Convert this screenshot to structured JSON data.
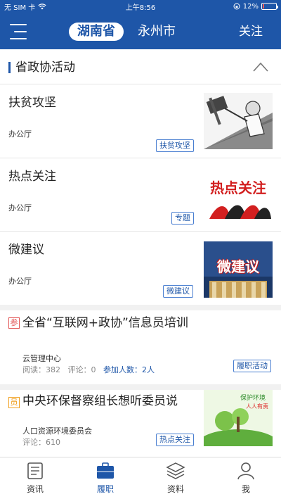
{
  "status": {
    "carrier": "无 SIM 卡",
    "time": "上午8:56",
    "battery": "12%",
    "battery_level": 0.12
  },
  "header": {
    "province": "湖南省",
    "city": "永州市",
    "follow_label": "关注"
  },
  "section": {
    "title": "省政协活动"
  },
  "items": [
    {
      "title": "扶贫攻坚",
      "source": "办公厅",
      "tag": "扶贫攻坚"
    },
    {
      "title": "热点关注",
      "source": "办公厅",
      "tag": "专题",
      "image_text": "热点关注"
    },
    {
      "title": "微建议",
      "source": "办公厅",
      "tag": "微建议",
      "image_text": "微建议"
    },
    {
      "title": "全省“互联网+政协”信息员培训",
      "badge": "参",
      "source": "云管理中心",
      "meta": {
        "read_label": "阅读",
        "read": "382",
        "comment_label": "评论",
        "comment": "0",
        "join_label": "参加人数",
        "join": "2人"
      },
      "tag": "履职活动"
    },
    {
      "title": "中央环保督察组长想听委员说",
      "badge": "员",
      "source": "人口资源环境委员会",
      "meta": {
        "comment_label": "评论",
        "comment": "610"
      },
      "tag": "热点关注"
    }
  ],
  "tabbar": [
    {
      "label": "资讯",
      "icon": "news-icon",
      "active": false
    },
    {
      "label": "履职",
      "icon": "briefcase-icon",
      "active": true
    },
    {
      "label": "资料",
      "icon": "layers-icon",
      "active": false
    },
    {
      "label": "我",
      "icon": "person-icon",
      "active": false
    }
  ],
  "colors": {
    "brand": "#1e56a8",
    "badge_red": "#e25555",
    "badge_orange": "#f0a020"
  }
}
